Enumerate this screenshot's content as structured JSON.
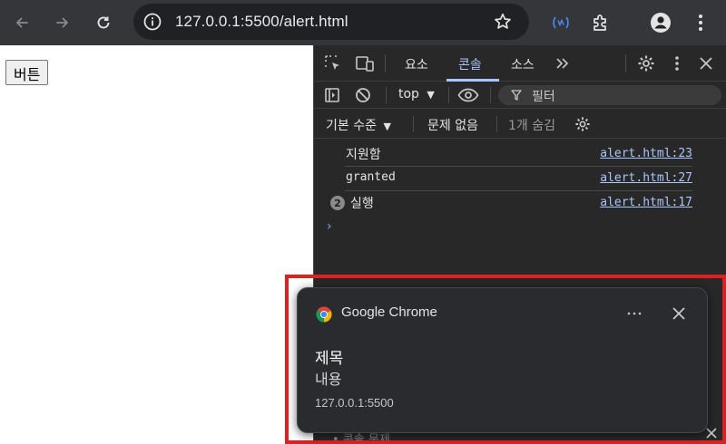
{
  "browser": {
    "url_host": "127.0.0.1",
    "url_path": ":5500/alert.html"
  },
  "page": {
    "button_label": "버튼"
  },
  "devtools": {
    "tabs": [
      {
        "label": "요소",
        "active": false
      },
      {
        "label": "콘솔",
        "active": true
      },
      {
        "label": "소스",
        "active": false
      }
    ],
    "context": "top",
    "filter_placeholder": "필터",
    "log_level": "기본 수준",
    "issues": "문제 없음",
    "hidden_count": "1개 숨김",
    "messages": [
      {
        "text": "지원함",
        "source": "alert.html:23",
        "count": ""
      },
      {
        "text": "granted",
        "source": "alert.html:27",
        "count": ""
      },
      {
        "text": "실행",
        "source": "alert.html:17",
        "count": "2"
      }
    ],
    "prompt": "›",
    "drawer_text": "• 콘솔   문제"
  },
  "notification": {
    "app_name": "Google Chrome",
    "title": "제목",
    "body": "내용",
    "origin": "127.0.0.1:5500"
  },
  "colors": {
    "highlight": "#e02020",
    "link": "#a8c7fa",
    "toolbar": "#35363a",
    "devtools_bg": "#282828"
  }
}
